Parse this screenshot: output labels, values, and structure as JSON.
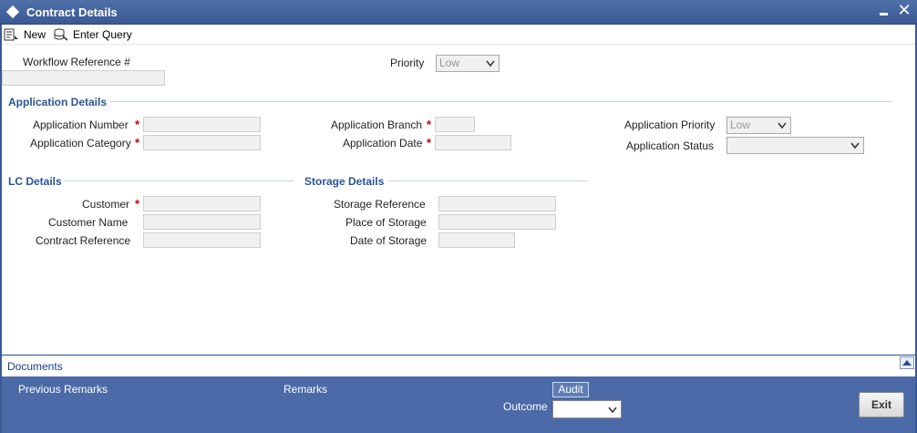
{
  "window": {
    "title": "Contract Details"
  },
  "toolbar": {
    "new_label": "New",
    "enter_query_label": "Enter Query"
  },
  "header_fields": {
    "workflow_reference_label": "Workflow Reference #",
    "priority_label": "Priority",
    "priority_value": "Low"
  },
  "application_details": {
    "section_title": "Application Details",
    "application_number_label": "Application Number",
    "application_category_label": "Application Category",
    "application_branch_label": "Application Branch",
    "application_date_label": "Application Date",
    "application_priority_label": "Application Priority",
    "application_priority_value": "Low",
    "application_status_label": "Application Status",
    "application_status_value": ""
  },
  "lc_details": {
    "section_title": "LC Details",
    "customer_label": "Customer",
    "customer_name_label": "Customer Name",
    "contract_reference_label": "Contract Reference"
  },
  "storage_details": {
    "section_title": "Storage Details",
    "storage_reference_label": "Storage Reference",
    "place_of_storage_label": "Place of Storage",
    "date_of_storage_label": "Date of Storage"
  },
  "required_marker": "*",
  "documents": {
    "label": "Documents"
  },
  "footer": {
    "previous_remarks_label": "Previous Remarks",
    "remarks_label": "Remarks",
    "audit_label": "Audit",
    "outcome_label": "Outcome",
    "outcome_value": "",
    "exit_label": "Exit"
  },
  "colors": {
    "title_bar": "#3a5a94",
    "footer": "#4b6aa7",
    "section_heading": "#2a5597",
    "required": "#c00000"
  },
  "icons": [
    "new-document-icon",
    "enter-query-icon",
    "minimize-icon",
    "close-icon",
    "chevron-down-icon",
    "scroll-up-icon"
  ]
}
